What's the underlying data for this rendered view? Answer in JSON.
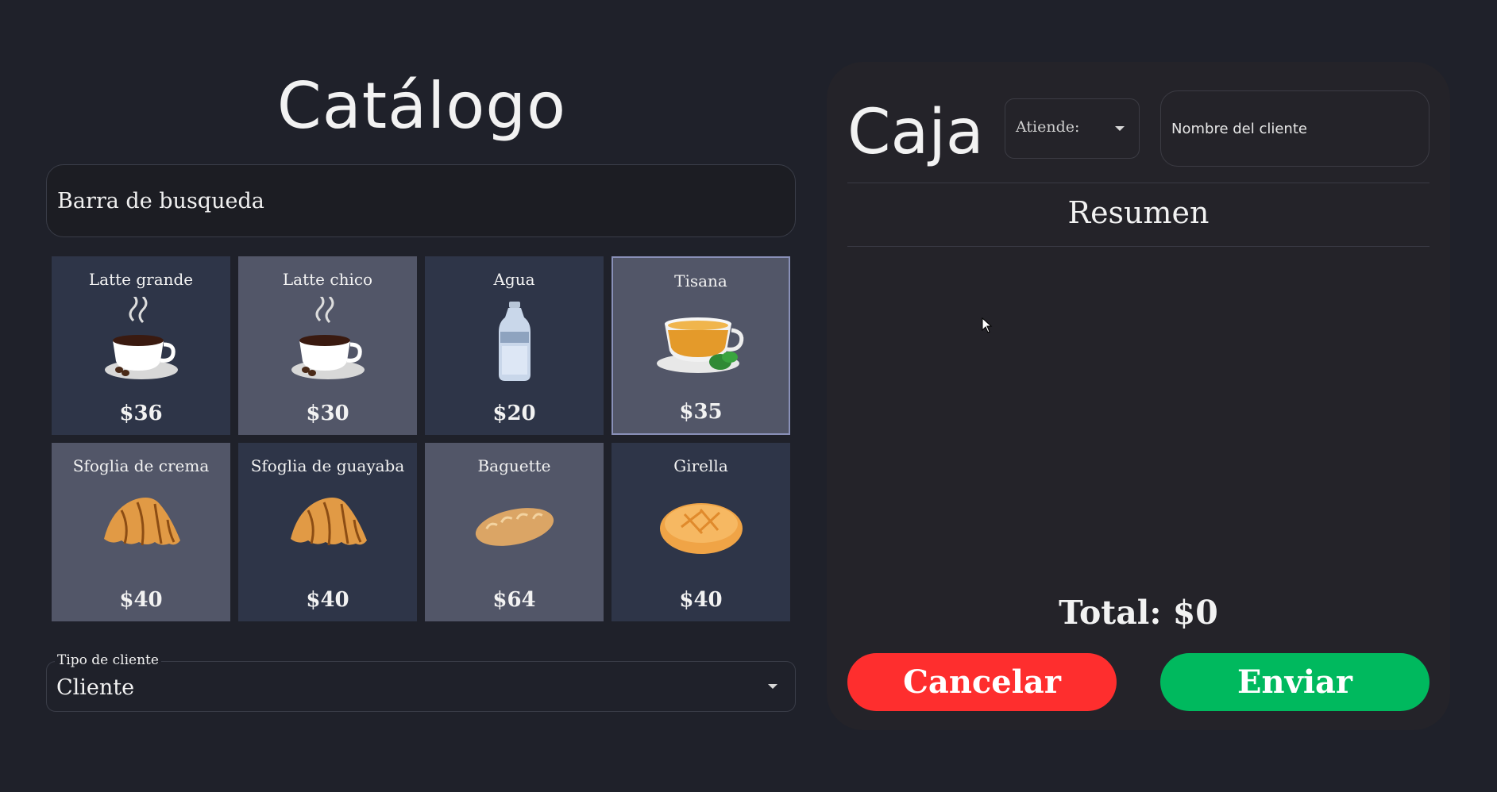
{
  "catalog": {
    "title": "Catálogo",
    "search_placeholder": "Barra de busqueda",
    "products": [
      {
        "name": "Latte grande",
        "price": "$36",
        "icon": "coffee-cup-icon"
      },
      {
        "name": "Latte chico",
        "price": "$30",
        "icon": "coffee-cup-icon"
      },
      {
        "name": "Agua",
        "price": "$20",
        "icon": "water-bottle-icon"
      },
      {
        "name": "Tisana",
        "price": "$35",
        "icon": "tea-cup-icon"
      },
      {
        "name": "Sfoglia de crema",
        "price": "$40",
        "icon": "croissant-icon"
      },
      {
        "name": "Sfoglia de guayaba",
        "price": "$40",
        "icon": "croissant-icon"
      },
      {
        "name": "Baguette",
        "price": "$64",
        "icon": "baguette-icon"
      },
      {
        "name": "Girella",
        "price": "$40",
        "icon": "bread-roll-icon"
      }
    ],
    "client_type": {
      "label": "Tipo de cliente",
      "value": "Cliente"
    }
  },
  "caja": {
    "title": "Caja",
    "attends_label": "Atiende:",
    "client_name_placeholder": "Nombre del cliente",
    "summary_title": "Resumen",
    "total": "Total: $0",
    "cancel_label": "Cancelar",
    "send_label": "Enviar"
  },
  "colors": {
    "background": "#1f212a",
    "card_dark": "#2e3548",
    "card_light": "#525668",
    "panel": "#242329",
    "cancel": "#fe2e2e",
    "send": "#00b95e"
  }
}
